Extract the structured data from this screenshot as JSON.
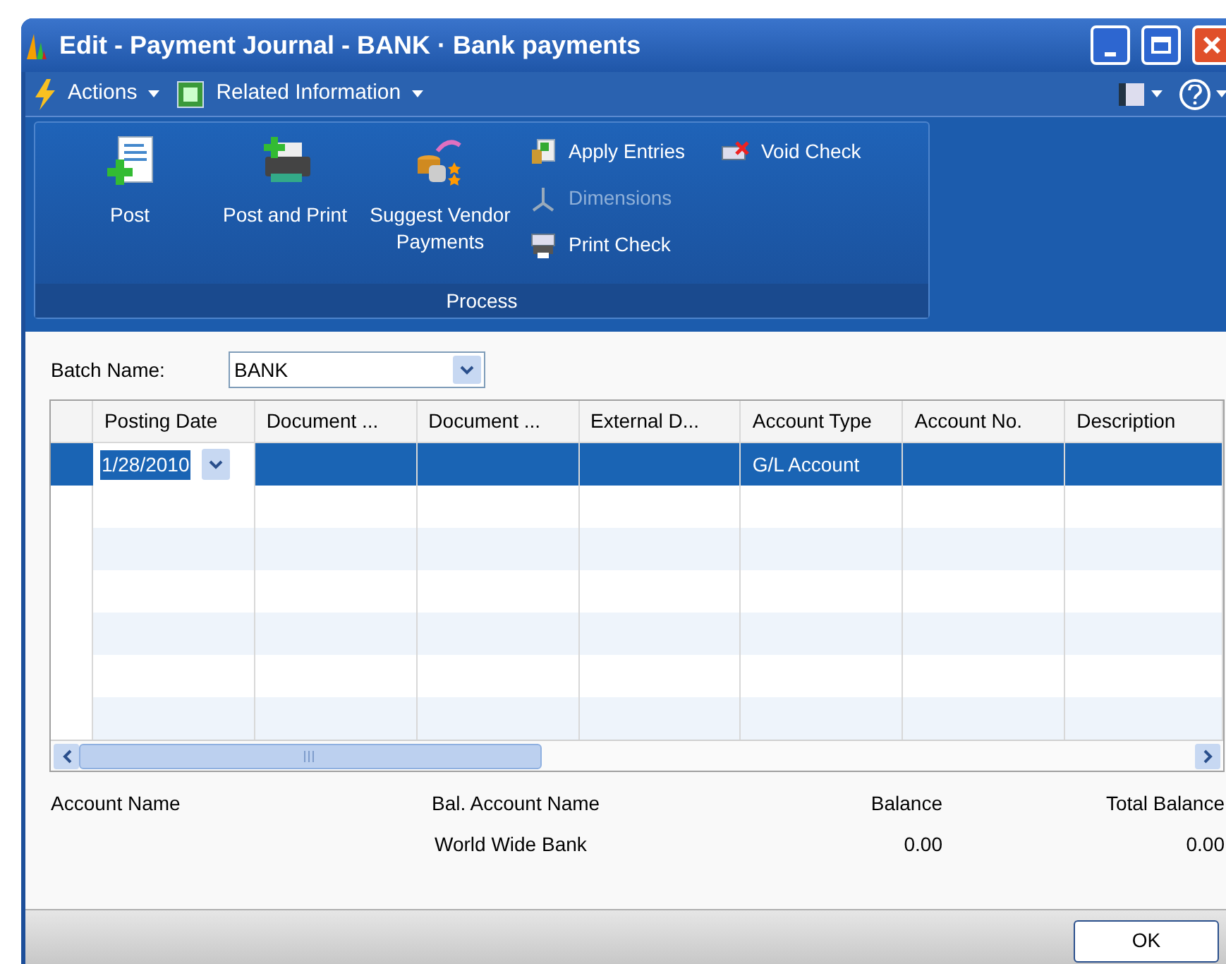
{
  "window": {
    "title": "Edit - Payment Journal - BANK · Bank payments"
  },
  "menu": [
    {
      "label": "Actions",
      "kind": "actions"
    },
    {
      "label": "Related Information",
      "kind": "related"
    }
  ],
  "ribbon": {
    "group": "Process",
    "actions": [
      {
        "label": "Post",
        "kind": "large",
        "disabled": false
      },
      {
        "label": "Post and Print",
        "kind": "large",
        "disabled": false
      },
      {
        "label": "Suggest Vendor Payments",
        "kind": "large",
        "disabled": false
      },
      {
        "label": "Apply Entries",
        "kind": "small",
        "disabled": false
      },
      {
        "label": "Dimensions",
        "kind": "small",
        "disabled": true
      },
      {
        "label": "Print Check",
        "kind": "small",
        "disabled": false
      },
      {
        "label": "Void Check",
        "kind": "small",
        "disabled": false
      }
    ]
  },
  "batch": {
    "label": "Batch Name:",
    "value": "BANK"
  },
  "table": {
    "columns": [
      "Posting Date",
      "Document ...",
      "Document ...",
      "External D...",
      "Account Type",
      "Account No.",
      "Description"
    ],
    "rows": [
      {
        "selected": true,
        "cells": [
          "1/28/2010",
          null,
          null,
          null,
          "G/L Account",
          null,
          null
        ]
      },
      {
        "selected": false
      },
      {
        "selected": false
      },
      {
        "selected": false
      },
      {
        "selected": false
      },
      {
        "selected": false
      },
      {
        "selected": false
      }
    ]
  },
  "totals": [
    {
      "label": "Account Name"
    },
    {
      "label": "Bal. Account Name",
      "value": "World Wide Bank"
    },
    {
      "label": "Balance",
      "value": "0.00"
    },
    {
      "label": "Total Balance",
      "value": "0.00"
    }
  ],
  "buttons": [
    "OK"
  ]
}
